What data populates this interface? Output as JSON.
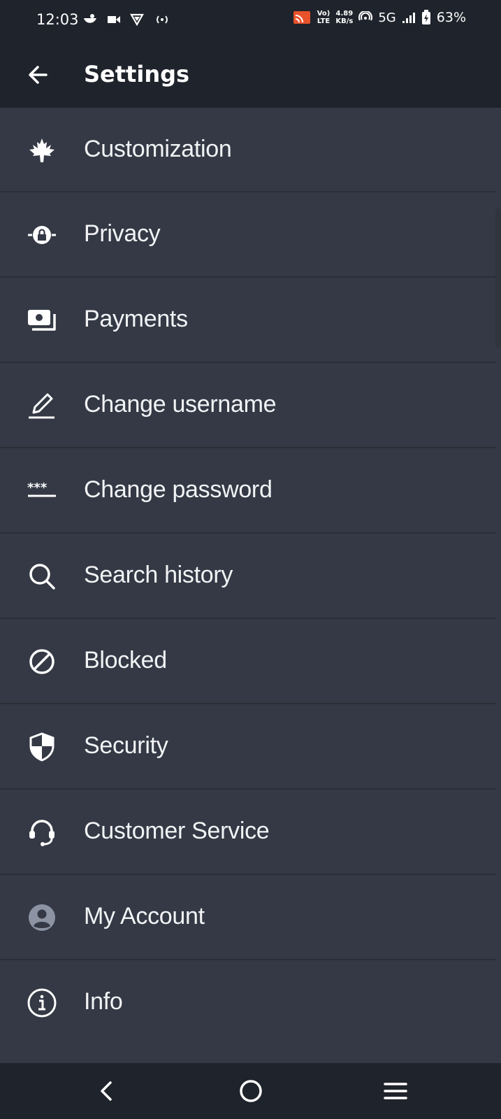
{
  "status_bar": {
    "time": "12:03",
    "volte": "Vo)",
    "lte": "LTE",
    "speed_value": "4.89",
    "speed_unit": "KB/s",
    "network": "5G",
    "battery": "63%"
  },
  "header": {
    "title": "Settings"
  },
  "settings": {
    "items": [
      {
        "label": "Customization",
        "icon": "maple-leaf-icon"
      },
      {
        "label": "Privacy",
        "icon": "privacy-lock-icon"
      },
      {
        "label": "Payments",
        "icon": "payments-icon"
      },
      {
        "label": "Change username",
        "icon": "pencil-icon"
      },
      {
        "label": "Change password",
        "icon": "password-icon"
      },
      {
        "label": "Search history",
        "icon": "search-icon"
      },
      {
        "label": "Blocked",
        "icon": "blocked-icon"
      },
      {
        "label": "Security",
        "icon": "shield-icon"
      },
      {
        "label": "Customer Service",
        "icon": "headset-icon"
      },
      {
        "label": "My Account",
        "icon": "account-icon"
      },
      {
        "label": "Info",
        "icon": "info-icon"
      }
    ]
  },
  "colors": {
    "background": "#343945",
    "bar": "#1f232b",
    "divider": "#2a2e37",
    "text": "#f2f3f5",
    "cast_accent": "#e8532b"
  }
}
